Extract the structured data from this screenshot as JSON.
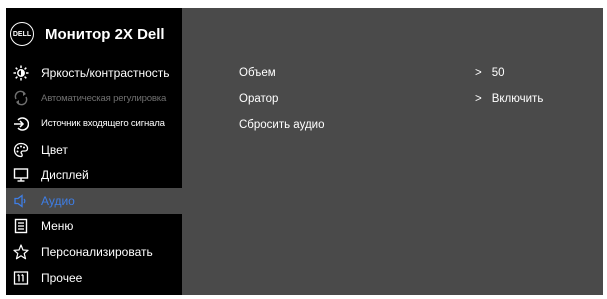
{
  "header": {
    "logo_text": "DELL",
    "title": "Монитор 2X Dell"
  },
  "sidebar": {
    "items": [
      {
        "label": "Яркость/контрастность",
        "icon": "brightness-icon",
        "state": "normal"
      },
      {
        "label": "Автоматическая регулировка",
        "icon": "auto-adjust-icon",
        "state": "disabled"
      },
      {
        "label": "Источник входящего сигнала",
        "icon": "input-source-icon",
        "state": "normal"
      },
      {
        "label": "Цвет",
        "icon": "color-palette-icon",
        "state": "normal"
      },
      {
        "label": "Дисплей",
        "icon": "display-icon",
        "state": "normal"
      },
      {
        "label": "Аудио",
        "icon": "speaker-icon",
        "state": "active"
      },
      {
        "label": "Меню",
        "icon": "menu-icon",
        "state": "normal"
      },
      {
        "label": "Персонализировать",
        "icon": "star-icon",
        "state": "normal"
      },
      {
        "label": "Прочее",
        "icon": "other-icon",
        "state": "normal"
      }
    ]
  },
  "content": {
    "rows": [
      {
        "label": "Объем",
        "arrow": ">",
        "value": "50"
      },
      {
        "label": "Оратор",
        "arrow": ">",
        "value": "Включить"
      },
      {
        "label": "Сбросить аудио",
        "arrow": "",
        "value": ""
      }
    ]
  },
  "colors": {
    "sidebar_bg": "#000000",
    "panel_bg": "#4a4a4a",
    "accent": "#3e7ee6",
    "disabled": "#707070",
    "text": "#ffffff"
  }
}
